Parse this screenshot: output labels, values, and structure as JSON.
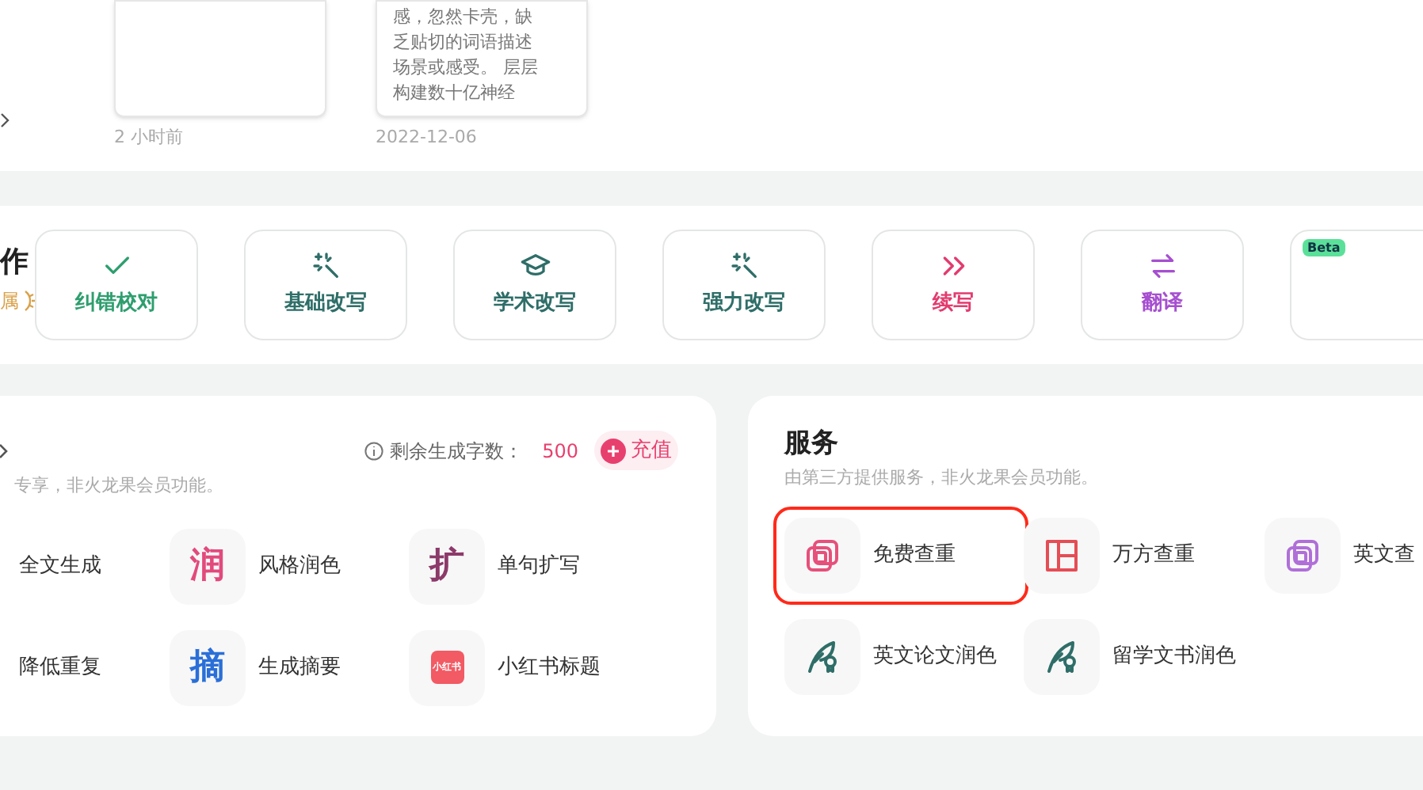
{
  "recent": {
    "cards": [
      {
        "time": "2 小时前"
      },
      {
        "lines": [
          "感，忽然卡壳，缺",
          "乏贴切的词语描述",
          "场景或感受。 层层",
          "构建数十亿神经"
        ],
        "time": "2022-12-06"
      }
    ]
  },
  "writing": {
    "title": "作",
    "badge": "属",
    "tools": [
      {
        "label": "纠错校对"
      },
      {
        "label": "基础改写"
      },
      {
        "label": "学术改写"
      },
      {
        "label": "强力改写"
      },
      {
        "label": "续写"
      },
      {
        "label": "翻译"
      },
      {
        "beta_label": "Beta"
      }
    ]
  },
  "ai_panel": {
    "remaining_label": "剩余生成字数：",
    "remaining": "500",
    "recharge": "充值",
    "subtitle": "专享，非火龙果会员功能。",
    "items": [
      {
        "label": "全文生成",
        "kind": "plain"
      },
      {
        "label": "风格润色",
        "kind": "char",
        "glyph": "润"
      },
      {
        "label": "单句扩写",
        "kind": "char",
        "glyph": "扩"
      },
      {
        "label": "降低重复",
        "kind": "plain"
      },
      {
        "label": "生成摘要",
        "kind": "char",
        "glyph": "摘"
      },
      {
        "label": "小红书标题",
        "kind": "logo",
        "glyph": "小红书"
      }
    ]
  },
  "services": {
    "title": "服务",
    "subtitle": "由第三方提供服务，非火龙果会员功能。",
    "items": [
      {
        "label": "免费查重",
        "highlighted": true
      },
      {
        "label": "万方查重",
        "highlighted": false
      },
      {
        "label": "英文查",
        "highlighted": false
      },
      {
        "label": "英文论文润色",
        "highlighted": false
      },
      {
        "label": "留学文书润色",
        "highlighted": false
      }
    ]
  }
}
